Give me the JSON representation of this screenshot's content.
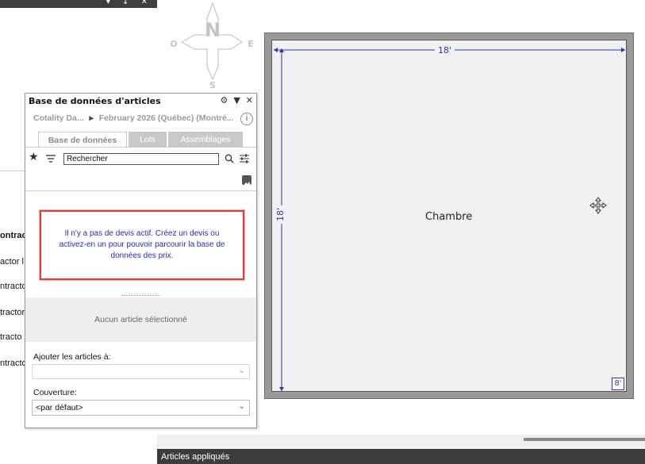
{
  "background_panel": {
    "window_controls": "▾ ↕ ✕",
    "rows": [
      "ontrac",
      "actor l",
      "ntracto",
      "tractor",
      "tracto",
      "ntracto"
    ]
  },
  "compass": {
    "north": "N",
    "south": "S",
    "east": "E",
    "west": "O"
  },
  "floor_plan": {
    "room_name": "Chambre",
    "width_dim": "18'",
    "height_dim": "18'",
    "ceiling_height": "8'"
  },
  "panel": {
    "title": "Base de données d'articles",
    "breadcrumb": {
      "source": "Cotality Da...",
      "separator": "▸",
      "period": "February 2026 (Québec) (Montré..."
    },
    "info_icon": "i",
    "tabs": [
      {
        "label": "Base de données",
        "active": true
      },
      {
        "label": "Lots",
        "active": false
      },
      {
        "label": "Assemblages",
        "active": false
      }
    ],
    "search": {
      "value": "Rechercher",
      "placeholder": ""
    },
    "message": "Il n'y a pas de devis actif. Créez un devis ou activez-en un pour pouvoir parcourir la base de données des prix.",
    "no_selection": "Aucun article sélectionné",
    "add_to": {
      "label": "Ajouter les articles à:",
      "value": ""
    },
    "coverage": {
      "label": "Couverture:",
      "value": "<par défaut>"
    }
  },
  "bottom_bar": {
    "title": "Articles appliqués"
  },
  "colors": {
    "accent_red": "#e03c3c",
    "dimension_blue": "#3333aa",
    "message_blue": "#2b2bb2",
    "bar_dark": "#3c3c3c"
  }
}
